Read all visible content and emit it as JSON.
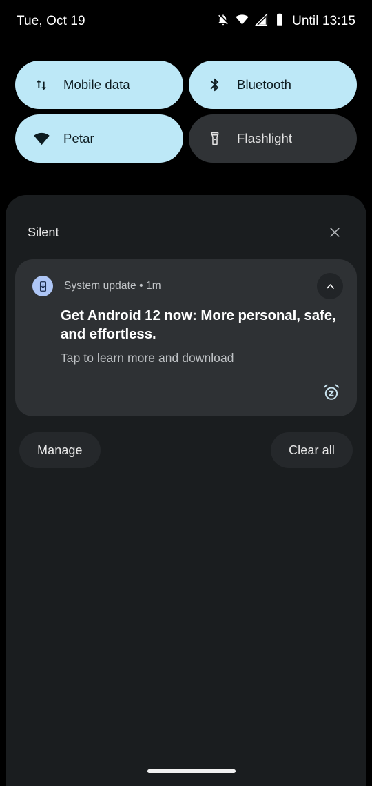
{
  "status_bar": {
    "clock": "Tue, Oct 19",
    "until_label": "Until 13:15",
    "icons": [
      {
        "name": "notifications-off-icon",
        "label": "Silent mode"
      },
      {
        "name": "wifi-icon",
        "label": "Wi-Fi full signal"
      },
      {
        "name": "cellular-signal-icon",
        "label": "Mobile signal"
      },
      {
        "name": "battery-icon",
        "label": "Battery"
      }
    ]
  },
  "quick_settings": {
    "tiles": [
      {
        "label": "Mobile data",
        "icon": "mobile-data-icon",
        "state": "on"
      },
      {
        "label": "Bluetooth",
        "icon": "bluetooth-icon",
        "state": "on"
      },
      {
        "label": "Petar",
        "icon": "wifi-icon",
        "state": "on"
      },
      {
        "label": "Flashlight",
        "icon": "flashlight-icon",
        "state": "off"
      }
    ],
    "colors": {
      "active_bg": "#bde8f7",
      "active_fg": "#0d1b20",
      "inactive_bg": "#303336",
      "inactive_fg": "#e3e3e3"
    }
  },
  "shade": {
    "section_title": "Silent",
    "close_icon": "close-icon",
    "background": "#1a1d1f",
    "notification": {
      "app_name": "System update",
      "separator": "•",
      "time": "1m",
      "meta": "System update • 1m",
      "title": "Get Android 12 now: More personal, safe, and effortless.",
      "body": "Tap to learn more and download",
      "app_icon": "system-update-icon",
      "expand_icon": "chevron-up-icon",
      "snooze_icon": "snooze-alarm-icon",
      "card_color": "#2e3134"
    },
    "actions": {
      "manage_label": "Manage",
      "clear_all_label": "Clear all"
    }
  },
  "nav_bar": {
    "handle": "home-gesture-handle"
  }
}
